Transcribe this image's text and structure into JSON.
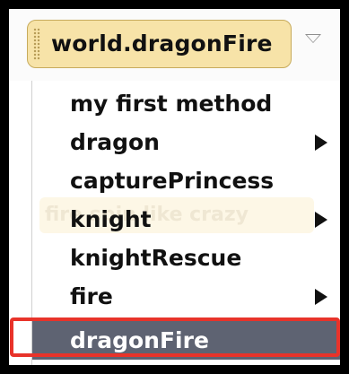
{
  "header": {
    "tile_label": "world.dragonFire",
    "dropdown_icon": "triangle-down-icon"
  },
  "background_hint": {
    "text": "fire spin like crazy"
  },
  "menu": {
    "items": [
      {
        "label": "my first method",
        "has_submenu": false
      },
      {
        "label": "dragon",
        "has_submenu": true
      },
      {
        "label": "capturePrincess",
        "has_submenu": false
      },
      {
        "label": "knight",
        "has_submenu": true
      },
      {
        "label": "knightRescue",
        "has_submenu": false
      },
      {
        "label": "fire",
        "has_submenu": true
      },
      {
        "label": "dragonFire",
        "has_submenu": false,
        "selected": true
      }
    ]
  },
  "colors": {
    "tile_fill": "#f7e3a8",
    "selected_row": "#5e6372",
    "highlight_outline": "#e8332a"
  }
}
